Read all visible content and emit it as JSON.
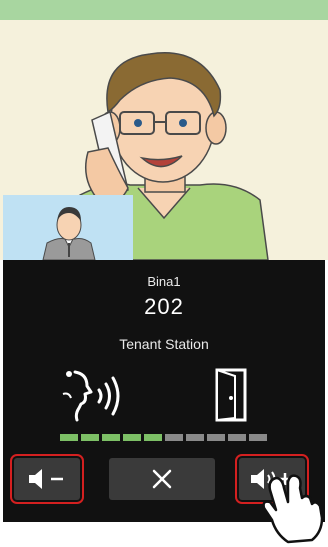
{
  "call": {
    "caller_name": "Bina1",
    "room_number": "202",
    "station_type": "Tenant Station"
  },
  "volume_meter": {
    "level": 5,
    "max": 10,
    "active_color": "#7dc066",
    "inactive_color": "#8a8a8a"
  },
  "controls": {
    "volume_down": {
      "icon": "speaker-minus-icon"
    },
    "end_call": {
      "icon": "close-icon"
    },
    "volume_up": {
      "icon": "speaker-plus-icon"
    }
  },
  "colors": {
    "highlight": "#d42020",
    "panel_bg": "#111111",
    "button_bg": "#3a3a3a",
    "top_strip": "#a8d6a0"
  }
}
